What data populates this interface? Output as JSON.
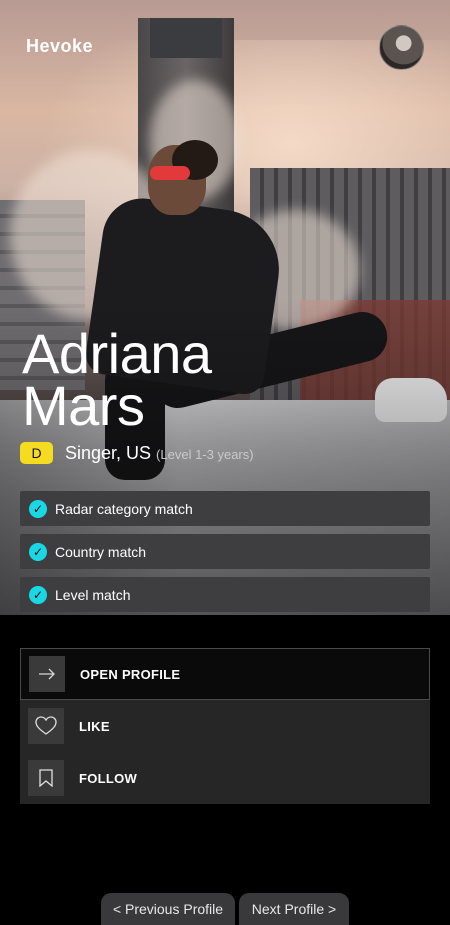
{
  "app": {
    "logo": "Hevoke"
  },
  "profile": {
    "first_name": "Adriana",
    "last_name": "Mars",
    "level_badge": "D",
    "role": "Singer, US",
    "level_text": "(Level 1-3 years)"
  },
  "matches": [
    {
      "label": "Radar category match",
      "icon": "check-icon"
    },
    {
      "label": "Country match",
      "icon": "check-icon"
    },
    {
      "label": "Level match",
      "icon": "check-icon"
    }
  ],
  "actions": {
    "open_profile": {
      "label": "OPEN PROFILE",
      "icon": "arrow-right-icon"
    },
    "like": {
      "label": "LIKE",
      "icon": "heart-icon"
    },
    "follow": {
      "label": "FOLLOW",
      "icon": "bookmark-icon"
    }
  },
  "nav": {
    "previous": "< Previous Profile",
    "next": "Next Profile >"
  },
  "colors": {
    "badge": "#f6dc21",
    "check": "#19d8e6",
    "background": "#000000",
    "card": "#3e3e40"
  }
}
